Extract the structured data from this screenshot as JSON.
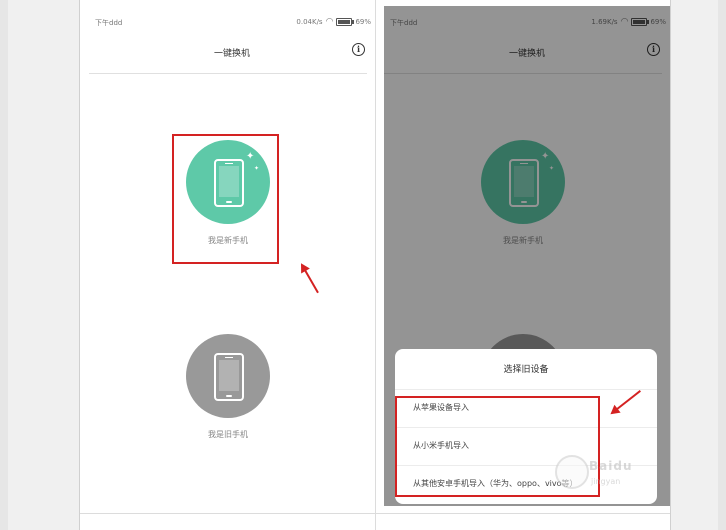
{
  "left_phone": {
    "status": {
      "time": "下午ddd",
      "speed": "0.04K/s",
      "battery": "69%"
    },
    "title": "一键换机",
    "new_phone_label": "我是新手机",
    "old_phone_label": "我是旧手机"
  },
  "right_phone": {
    "status": {
      "time": "下午ddd",
      "speed": "1.69K/s",
      "battery": "69%"
    },
    "title": "一键换机",
    "new_phone_label": "我是新手机",
    "sheet": {
      "title": "选择旧设备",
      "options": [
        "从苹果设备导入",
        "从小米手机导入",
        "从其他安卓手机导入（华为、oppo、vivo等）"
      ]
    }
  },
  "colors": {
    "accent_green": "#5ec9a8",
    "old_phone_gray": "#999999",
    "annotation_red": "#d42222"
  },
  "watermark": {
    "brand": "Baidu",
    "sub": "jingyan"
  }
}
